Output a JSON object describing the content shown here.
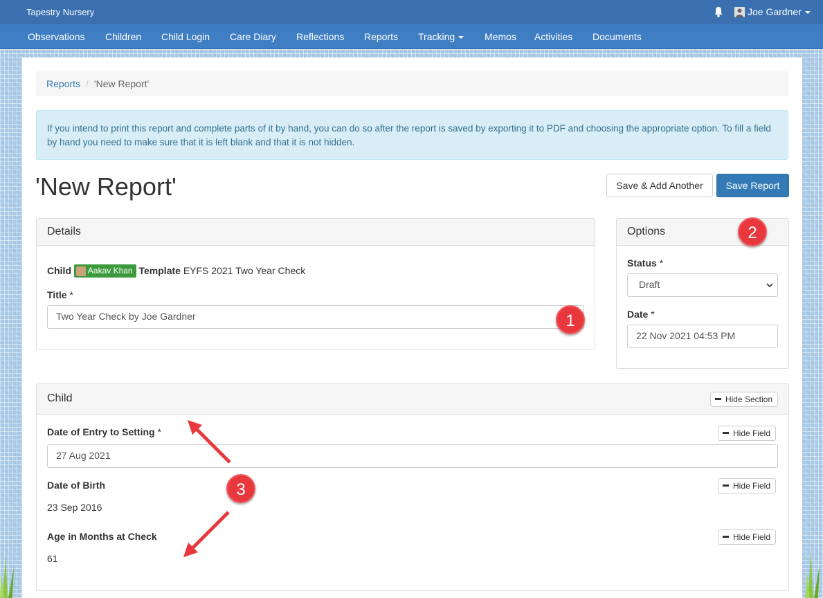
{
  "app": {
    "brand": "Tapestry Nursery",
    "user_name": "Joe Gardner"
  },
  "nav": {
    "items": [
      "Observations",
      "Children",
      "Child Login",
      "Care Diary",
      "Reflections",
      "Reports",
      "Tracking",
      "Memos",
      "Activities",
      "Documents"
    ]
  },
  "breadcrumb": {
    "link": "Reports",
    "separator": "/",
    "current": "'New Report'"
  },
  "alert": {
    "text": "If you intend to print this report and complete parts of it by hand, you can do so after the report is saved by exporting it to PDF and choosing the appropriate option. To fill a field by hand you need to make sure that it is left blank and that it is not hidden."
  },
  "page": {
    "title": "'New Report'",
    "save_add_another": "Save & Add Another",
    "save_report": "Save Report"
  },
  "details": {
    "heading": "Details",
    "child_label": "Child",
    "child_name": "Aakav Khan",
    "template_label": "Template",
    "template_value": "EYFS 2021 Two Year Check",
    "title_label": "Title",
    "required_mark": "*",
    "title_value": "Two Year Check by Joe Gardner"
  },
  "options": {
    "heading": "Options",
    "status_label": "Status",
    "status_value": "Draft",
    "date_label": "Date",
    "date_value": "22 Nov 2021 04:53 PM"
  },
  "child_section": {
    "heading": "Child",
    "hide_section": "Hide Section",
    "hide_field": "Hide Field",
    "fields": [
      {
        "label": "Date of Entry to Setting",
        "value": "27 Aug 2021"
      },
      {
        "label": "Date of Birth",
        "value": "23 Sep 2016"
      },
      {
        "label": "Age in Months at Check",
        "value": "61"
      }
    ]
  },
  "annotations": {
    "m1": "1",
    "m2": "2",
    "m3": "3"
  },
  "colors": {
    "topbar": "#3a70b0",
    "navbar": "#3f7ec3",
    "primary": "#337ab7",
    "child_badge": "#3c9a3c",
    "marker": "#e8383d"
  }
}
